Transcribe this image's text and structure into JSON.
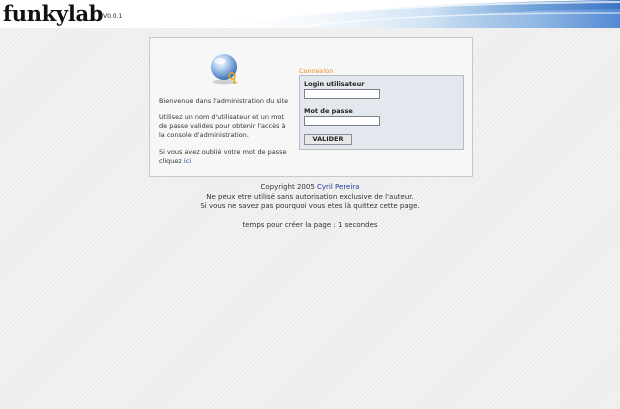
{
  "header": {
    "logo": "funkylab",
    "version": "V0.0.1"
  },
  "intro": {
    "welcome": "Bienvenue dans l'administration du site",
    "instructions": "Utilisez un nom d'utilisateur et un mot de passe valides pour obtenir l'accès à la console d'administration.",
    "forgot_text": "Si vous avez oublié votre mot de passe cliquez",
    "forgot_link": "ici"
  },
  "login": {
    "title": "Connexion",
    "username_label": "Login utilisateur",
    "username_value": "",
    "password_label": "Mot de passe",
    "password_value": "",
    "submit_label": "VALIDER"
  },
  "footer": {
    "copyright_prefix": "Copyright 2005",
    "author_link": "Cyril Pereira",
    "notice": "Ne peux etre utilisé sans autorisation exclusive de l'auteur.",
    "notice2": "Si vous ne savez pas pourquoi vous etes là quittez cette page.",
    "gen_time": "temps pour créer la page : 1 secondes"
  },
  "colors": {
    "accent_orange": "#f08a1c",
    "link_blue": "#1a3a9a",
    "login_box_bg": "#e3e8ee"
  },
  "icons": {
    "key": "key-icon"
  }
}
